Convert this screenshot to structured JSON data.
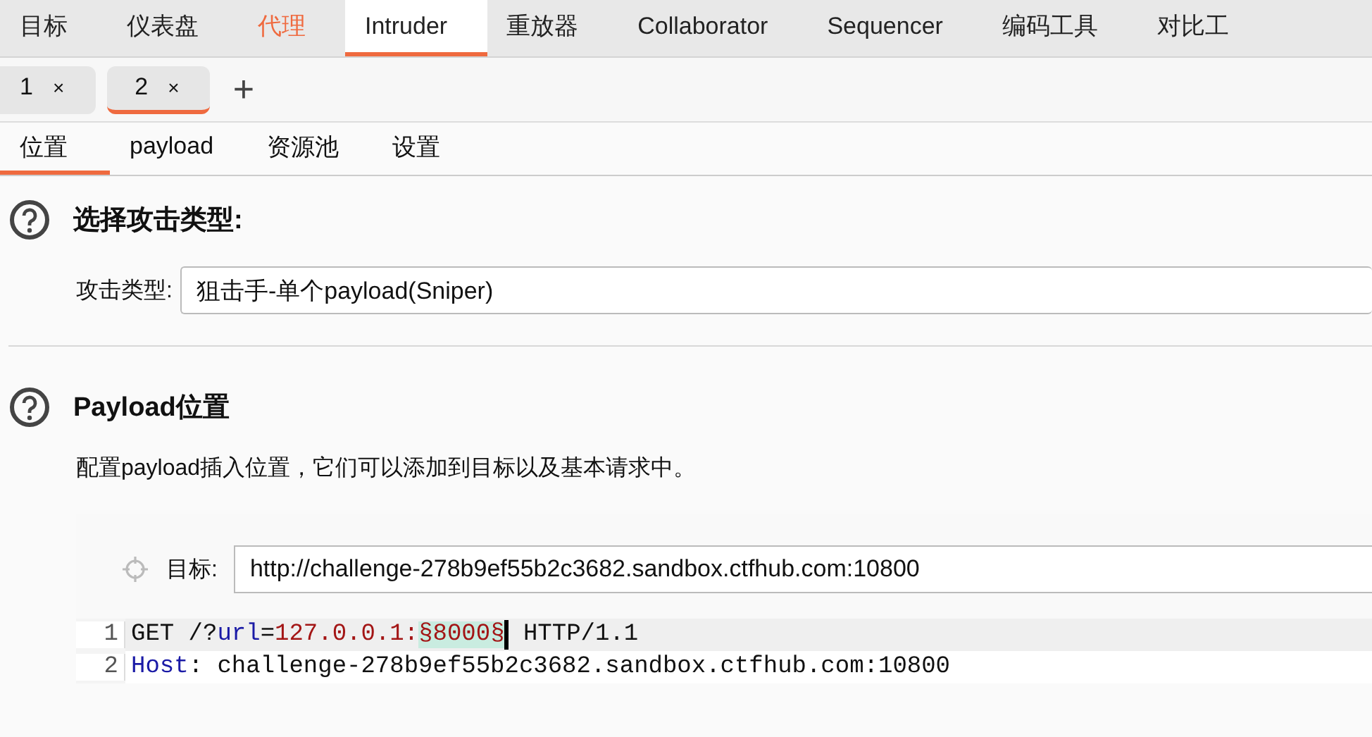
{
  "main_tabs": [
    {
      "label": "目标",
      "selected": false,
      "alert": false
    },
    {
      "label": "仪表盘",
      "selected": false,
      "alert": false
    },
    {
      "label": "代理",
      "selected": false,
      "alert": true
    },
    {
      "label": "Intruder",
      "selected": true,
      "alert": false
    },
    {
      "label": "重放器",
      "selected": false,
      "alert": false
    },
    {
      "label": "Collaborator",
      "selected": false,
      "alert": false
    },
    {
      "label": "Sequencer",
      "selected": false,
      "alert": false
    },
    {
      "label": "编码工具",
      "selected": false,
      "alert": false
    },
    {
      "label": "对比工",
      "selected": false,
      "alert": false
    }
  ],
  "attack_tabs": [
    {
      "label": "1",
      "close": "×",
      "selected": false
    },
    {
      "label": "2",
      "close": "×",
      "selected": true
    }
  ],
  "add_tab": "+",
  "sub_tabs": [
    {
      "label": "位置",
      "selected": true
    },
    {
      "label": "payload",
      "selected": false
    },
    {
      "label": "资源池",
      "selected": false
    },
    {
      "label": "设置",
      "selected": false
    }
  ],
  "attack_type": {
    "heading": "选择攻击类型:",
    "label": "攻击类型:",
    "value": "狙击手-单个payload(Sniper)"
  },
  "positions": {
    "heading": "Payload位置",
    "description": "配置payload插入位置，它们可以添加到目标以及基本请求中。",
    "target_label": "目标:",
    "target_value": "http://challenge-278b9ef55b2c3682.sandbox.ctfhub.com:10800"
  },
  "editor_lines": [
    {
      "number": "1",
      "current": true,
      "segments": [
        {
          "kind": "plain",
          "text": "GET /?"
        },
        {
          "kind": "name",
          "text": "url"
        },
        {
          "kind": "plain",
          "text": "="
        },
        {
          "kind": "value",
          "text": "127.0.0.1:"
        },
        {
          "kind": "payload",
          "text": "§8000§"
        },
        {
          "kind": "cursor"
        },
        {
          "kind": "plain",
          "text": " HTTP/1.1"
        }
      ]
    },
    {
      "number": "2",
      "current": false,
      "segments": [
        {
          "kind": "name",
          "text": "Host"
        },
        {
          "kind": "plain",
          "text": ": challenge-278b9ef55b2c3682.sandbox.ctfhub.com:10800"
        }
      ]
    }
  ]
}
